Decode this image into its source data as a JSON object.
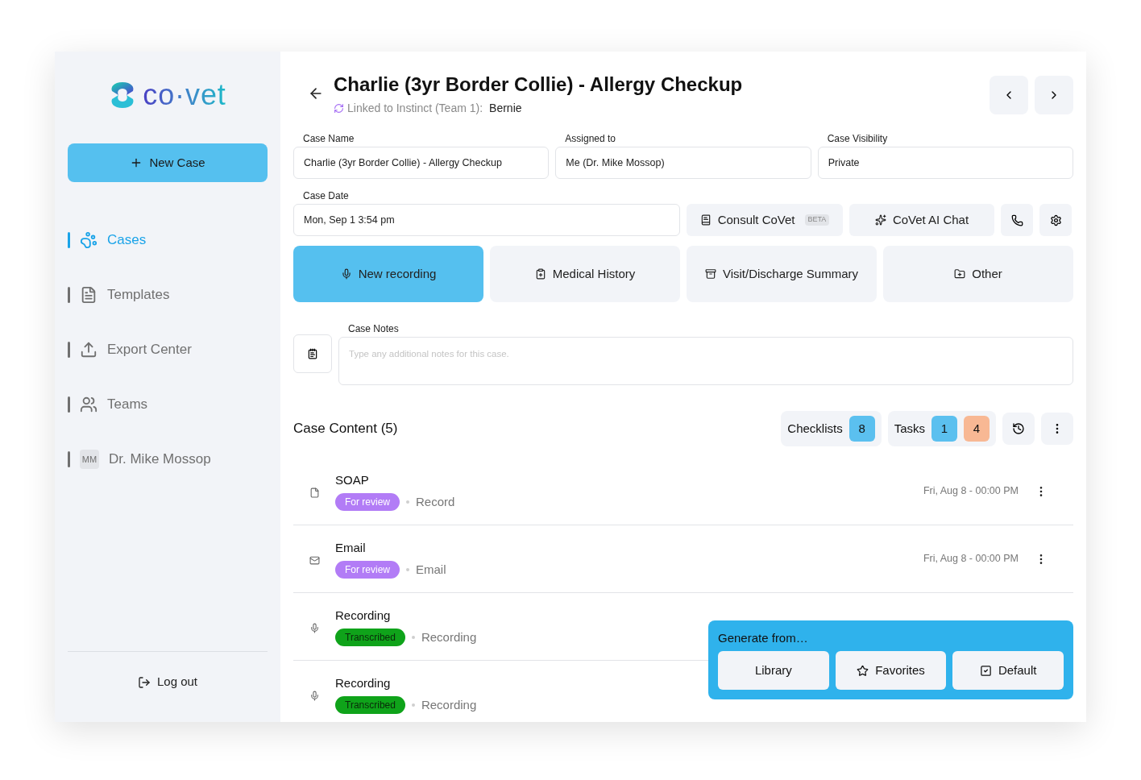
{
  "logo": {
    "text": "co·vet"
  },
  "new_case_button": {
    "label": "New Case"
  },
  "nav": [
    {
      "label": "Cases",
      "kind": "paw",
      "selected": true
    },
    {
      "label": "Templates",
      "kind": "document",
      "selected": false
    },
    {
      "label": "Export Center",
      "kind": "upload",
      "selected": false
    },
    {
      "label": "Teams",
      "kind": "users",
      "selected": false
    },
    {
      "label": "Dr. Mike Mossop",
      "kind": "avatar",
      "initials": "MM",
      "selected": false
    }
  ],
  "logout": {
    "label": "Log out"
  },
  "header": {
    "title": "Charlie (3yr Border Collie) - Allergy Checkup",
    "linked_label": "Linked to Instinct (Team 1):",
    "linked_value": "Bernie"
  },
  "fields": [
    {
      "label": "Case Name",
      "value": "Charlie (3yr Border Collie) - Allergy Checkup"
    },
    {
      "label": "Assigned to",
      "value": "Me (Dr. Mike Mossop)"
    },
    {
      "label": "Case Visibility",
      "value": "Private"
    }
  ],
  "case_date": {
    "label": "Case Date",
    "value": "Mon, Sep 1 3:54 pm"
  },
  "actions": [
    {
      "label": "Consult CoVet",
      "kind": "book",
      "badge": "BETA"
    },
    {
      "label": "CoVet AI Chat",
      "kind": "sparkles"
    }
  ],
  "create_buttons": [
    {
      "label": "New recording",
      "kind": "mic",
      "selected": true
    },
    {
      "label": "Medical History",
      "kind": "clipboard",
      "selected": false
    },
    {
      "label": "Visit/Discharge Summary",
      "kind": "archive",
      "selected": false
    },
    {
      "label": "Other",
      "kind": "folder",
      "selected": false
    }
  ],
  "notes": {
    "label": "Case Notes",
    "placeholder": "Type any additional notes for this case."
  },
  "content": {
    "title": "Case Content (5)",
    "checklists": {
      "label": "Checklists",
      "counts": [
        {
          "value": "8",
          "color": "#5bc0ef"
        }
      ]
    },
    "tasks": {
      "label": "Tasks",
      "counts": [
        {
          "value": "1",
          "color": "#5bc0ef"
        },
        {
          "value": "4",
          "color": "#f8b894"
        }
      ]
    },
    "items": [
      {
        "title": "SOAP",
        "kind": "file",
        "status": "For review",
        "color": "#b27cf6",
        "type": "Record",
        "date": "Fri, Aug 8 - 00:00 PM"
      },
      {
        "title": "Email",
        "kind": "mail",
        "status": "For review",
        "color": "#b27cf6",
        "type": "Email",
        "date": "Fri, Aug 8 - 00:00 PM"
      },
      {
        "title": "Recording",
        "kind": "mic",
        "status": "Transcribed",
        "color": "#0fa31a",
        "type": "Recording"
      },
      {
        "title": "Recording",
        "kind": "mic",
        "status": "Transcribed",
        "color": "#0fa31a",
        "type": "Recording"
      }
    ]
  },
  "popover": {
    "title": "Generate from…",
    "buttons": [
      {
        "label": "Library",
        "kind": "plain"
      },
      {
        "label": "Favorites",
        "kind": "star"
      },
      {
        "label": "Default",
        "kind": "check"
      }
    ]
  }
}
